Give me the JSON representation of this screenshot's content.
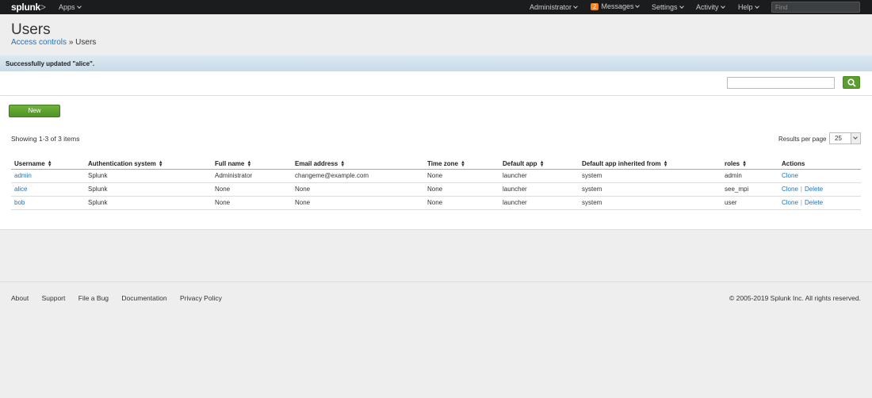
{
  "topbar": {
    "logo": "splunk",
    "logo_suffix": ">",
    "apps": "Apps",
    "user": "Administrator",
    "messages_count": "2",
    "messages": "Messages",
    "settings": "Settings",
    "activity": "Activity",
    "help": "Help",
    "find_placeholder": "Find"
  },
  "header": {
    "title": "Users",
    "breadcrumb_parent": "Access controls",
    "breadcrumb_sep": "»",
    "breadcrumb_current": "Users"
  },
  "message": "Successfully updated \"alice\".",
  "toolbar": {
    "new_label": "New",
    "showing": "Showing 1-3 of 3 items",
    "results_per_page_label": "Results per page",
    "results_per_page_value": "25"
  },
  "table": {
    "columns": [
      "Username",
      "Authentication system",
      "Full name",
      "Email address",
      "Time zone",
      "Default app",
      "Default app inherited from",
      "roles",
      "Actions"
    ],
    "clone_label": "Clone",
    "delete_label": "Delete",
    "rows": [
      {
        "username": "admin",
        "auth": "Splunk",
        "fullname": "Administrator",
        "email": "changeme@example.com",
        "tz": "None",
        "app": "launcher",
        "inherited": "system",
        "roles": "admin"
      },
      {
        "username": "alice",
        "auth": "Splunk",
        "fullname": "None",
        "email": "None",
        "tz": "None",
        "app": "launcher",
        "inherited": "system",
        "roles": "see_mpi"
      },
      {
        "username": "bob",
        "auth": "Splunk",
        "fullname": "None",
        "email": "None",
        "tz": "None",
        "app": "launcher",
        "inherited": "system",
        "roles": "user"
      }
    ]
  },
  "footer": {
    "links": [
      "About",
      "Support",
      "File a Bug",
      "Documentation",
      "Privacy Policy"
    ],
    "copyright": "© 2005-2019 Splunk Inc. All rights reserved."
  },
  "colors": {
    "topbar_bg": "#1a1c1e",
    "accent_green": "#5a9e2f",
    "link_blue": "#1e73be",
    "badge_orange": "#f58220"
  }
}
